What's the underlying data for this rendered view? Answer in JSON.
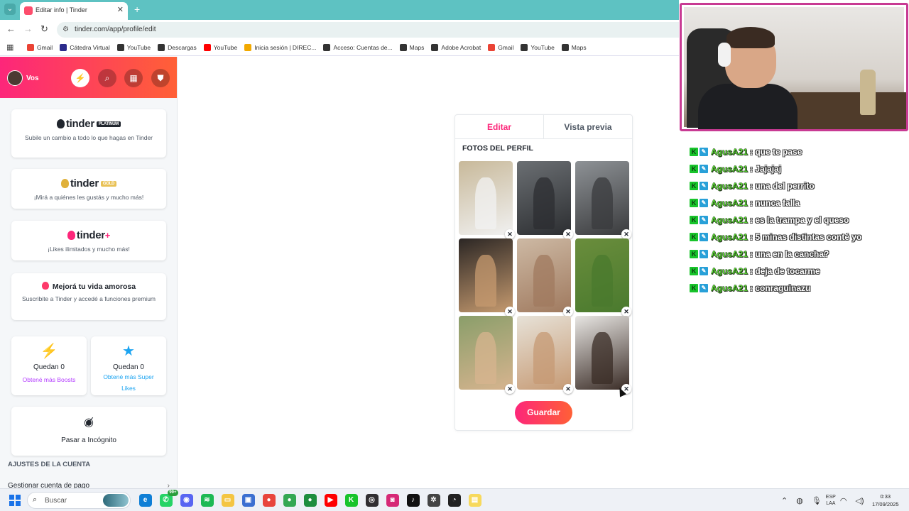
{
  "browser": {
    "tab_title": "Editar info | Tinder",
    "url": "tinder.com/app/profile/edit",
    "bookmarks": [
      {
        "label": "Gmail",
        "color": "#ea4335"
      },
      {
        "label": "Cátedra Virtual",
        "color": "#2b2b8c"
      },
      {
        "label": "YouTube",
        "color": "#333333"
      },
      {
        "label": "Descargas",
        "color": "#333333"
      },
      {
        "label": "YouTube",
        "color": "#ff0000"
      },
      {
        "label": "Inicia sesión | DIREC...",
        "color": "#f2a900"
      },
      {
        "label": "Acceso: Cuentas de...",
        "color": "#333333"
      },
      {
        "label": "Maps",
        "color": "#333333"
      },
      {
        "label": "Adobe Acrobat",
        "color": "#333333"
      },
      {
        "label": "Gmail",
        "color": "#ea4335"
      },
      {
        "label": "YouTube",
        "color": "#333333"
      },
      {
        "label": "Maps",
        "color": "#333333"
      }
    ]
  },
  "sidebar": {
    "user_label": "Vos",
    "header_buttons": [
      {
        "name": "boost-icon",
        "glyph": "⚡"
      },
      {
        "name": "explore-icon",
        "glyph": "⌕"
      },
      {
        "name": "briefcase-icon",
        "glyph": "▦"
      },
      {
        "name": "shield-icon",
        "glyph": "⛊"
      }
    ],
    "platinum": {
      "brand": "tinder",
      "badge": "PLATINUM",
      "desc": "Subile un cambio a todo lo que hagas en Tinder"
    },
    "gold": {
      "brand": "tinder",
      "badge": "GOLD",
      "desc": "¡Mirá a quiénes les gustás y mucho más!"
    },
    "plus": {
      "brand": "tinder",
      "badge": "+",
      "desc": "¡Likes ilimitados y mucho más!"
    },
    "love": {
      "title": "Mejorá tu vida amorosa",
      "desc": "Suscribite a Tinder y accedé a funciones premium"
    },
    "boosts": {
      "count": "Quedan 0",
      "link": "Obtené más Boosts"
    },
    "superlikes": {
      "count": "Quedan 0",
      "link": "Obtené más Super Likes"
    },
    "incognito": {
      "label": "Pasar a Incógnito"
    },
    "settings": {
      "title": "AJUSTES DE LA CUENTA",
      "item": "Gestionar cuenta de pago"
    }
  },
  "editor": {
    "tab_edit": "Editar",
    "tab_preview": "Vista previa",
    "section_title": "FOTOS DEL PERFIL",
    "save_label": "Guardar",
    "photos": [
      {
        "name": "hallway-mirror-selfie",
        "bg": "#c8b99a",
        "fig": "#f1f1f1"
      },
      {
        "name": "car-interior",
        "bg": "#6b6f73",
        "fig": "#2c2e31"
      },
      {
        "name": "gym-mirror",
        "bg": "#8e9296",
        "fig": "#3a3b3d"
      },
      {
        "name": "pug-dog",
        "bg": "#2b2624",
        "fig": "#c59a6f"
      },
      {
        "name": "covered-face",
        "bg": "#cdb9a4",
        "fig": "#a07a5f"
      },
      {
        "name": "dog-on-grass",
        "bg": "#6a8d3c",
        "fig": "#4a7a2e"
      },
      {
        "name": "smiling-beanie",
        "bg": "#8a9e6a",
        "fig": "#d7b48f"
      },
      {
        "name": "surprised-food",
        "bg": "#e7e2d8",
        "fig": "#c69a74"
      },
      {
        "name": "mirror-selfie-dark",
        "bg": "#e8e6e3",
        "fig": "#3a2c26"
      }
    ]
  },
  "chat": [
    {
      "user": "AgusA21",
      "msg": ": que te pase"
    },
    {
      "user": "AgusA21",
      "msg": ": Jajajaj"
    },
    {
      "user": "AgusA21",
      "msg": ": una del perrito"
    },
    {
      "user": "AgusA21",
      "msg": ": nunca falla"
    },
    {
      "user": "AgusA21",
      "msg": ": es la trampa y el queso"
    },
    {
      "user": "AgusA21",
      "msg": ": 5 minas distintas conté yo"
    },
    {
      "user": "AgusA21",
      "msg": ": una en la cancha?"
    },
    {
      "user": "AgusA21",
      "msg": ": deja de tocarme"
    },
    {
      "user": "AgusA21",
      "msg": ": conraguinazu"
    }
  ],
  "taskbar": {
    "search_placeholder": "Buscar",
    "apps": [
      {
        "name": "edge-icon",
        "color": "#0f7fd6",
        "glyph": "e"
      },
      {
        "name": "whatsapp-icon",
        "color": "#25d366",
        "glyph": "✆"
      },
      {
        "name": "discord-icon",
        "color": "#5865f2",
        "glyph": "◉"
      },
      {
        "name": "spotify-icon",
        "color": "#1db954",
        "glyph": "≋"
      },
      {
        "name": "folder-icon",
        "color": "#f4c542",
        "glyph": "▭"
      },
      {
        "name": "store-icon",
        "color": "#3b6fd1",
        "glyph": "▣"
      },
      {
        "name": "chrome-icon",
        "color": "#e8453c",
        "glyph": "●"
      },
      {
        "name": "chrome-icon-2",
        "color": "#34a853",
        "glyph": "●"
      },
      {
        "name": "chrome-icon-3",
        "color": "#1e8e3e",
        "glyph": "●"
      },
      {
        "name": "youtube-icon",
        "color": "#ff0000",
        "glyph": "▶"
      },
      {
        "name": "kick-icon",
        "color": "#18c42b",
        "glyph": "K"
      },
      {
        "name": "obs-icon",
        "color": "#302e31",
        "glyph": "◎"
      },
      {
        "name": "instagram-icon",
        "color": "#d62976",
        "glyph": "◙"
      },
      {
        "name": "tiktok-icon",
        "color": "#111111",
        "glyph": "♪"
      },
      {
        "name": "chatgpt-icon",
        "color": "#444444",
        "glyph": "✲"
      },
      {
        "name": "speedtest-icon",
        "color": "#222222",
        "glyph": "◔"
      },
      {
        "name": "notes-icon",
        "color": "#f7d95c",
        "glyph": "▤"
      }
    ],
    "whatsapp_badge": "99+",
    "lang_top": "ESP",
    "lang_bottom": "LAA",
    "time": "0:33",
    "date": "17/09/2025"
  }
}
